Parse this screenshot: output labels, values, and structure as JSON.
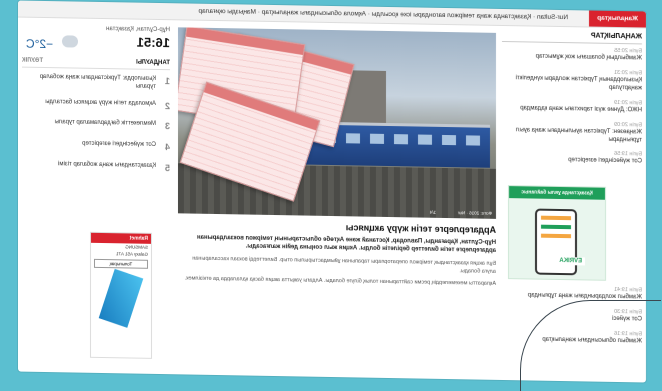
{
  "ticker": {
    "tag": "Жаңалықтар",
    "text": "Nur-Sultan · Қазақстанда жаңа теміржол вагондары іске қосылды · Ақмола облысындағы жаңалықтар · Маңызды оқиғалар"
  },
  "news_column": {
    "title": "ЖАҢАЛЫҚТАР",
    "items": [
      {
        "time": "Бүгін 20:55",
        "text": "Жамбылдың болашағы жоқ жұмыстар"
      },
      {
        "time": "Бүгін 20:31",
        "text": "Қызылорданың Түркістан жолдары күнделікті жаңартулар"
      },
      {
        "time": "Бүгін 20:19",
        "text": "НЖО: Дүние жүзі тарихтағы жаңа қадамдар"
      },
      {
        "time": "Бүгін 20:09",
        "text": "Жаңаөзен: Түркістан ауылындағы жаңа ауыл тұрғындары"
      },
      {
        "time": "Бүгін 19:56",
        "text": "Сот жүйесіндегі өзгерістер"
      },
      {
        "time": "Бүгін 19:41",
        "text": "Жамбыл жолдарындағы жаңа тұрғындар"
      },
      {
        "time": "Бүгін 19:30",
        "text": "Сот жүйесі"
      },
      {
        "time": "Бүгін 19:16",
        "text": "Жамбыл облысындағы жаңалықтар"
      }
    ]
  },
  "ad": {
    "header": "Қазақстанда ұялы байланыс",
    "logo": "EVRIKA"
  },
  "article": {
    "photo_credit": "Фото: 2016 · Nur",
    "photo_count": "1/4",
    "headline": "Ардагерлерге тегін жүру акциясы",
    "lead": "Нұр-Сұлтан, Қарағанды, Павлодар, Қостанай және Ақтөбе облыстарының теміржол вокзалдарынан ардагерлерге тегін билеттер берілетін болды. Акция жыл соңына дейін жалғасады.",
    "body_1": "Бұл акция қазақстандық теміржол операторлары тарапынан ұйымдастырылып отыр. Билеттерді вокзал кассаларынан алуға болады.",
    "body_2": "Ақпаратты мекемелердің ресми сайттарынан толық білуге болады. Алдағы уақытта акция басқа қалаларда да өткізілмек."
  },
  "sidebar": {
    "city": "Нұр-Сұлтан, Қазақстан",
    "time": "16:51",
    "temperature": "−2°C",
    "tabs": [
      "ТАҢДАУЛЫ",
      "ТӘУЛІК"
    ],
    "popular": [
      {
        "n": "1",
        "text": "Қызылорда: Түркістандағы жаңа жобалар туралы"
      },
      {
        "n": "2",
        "text": "Ақмолада тегін жүру акциясы басталды"
      },
      {
        "n": "3",
        "text": "Мемлекеттік бағдарламалар туралы"
      },
      {
        "n": "4",
        "text": "Сот жүйесіндегі өзгерістер"
      },
      {
        "n": "5",
        "text": "Қазақстандағы жаңа жобалар тізімі"
      }
    ],
    "banner": {
      "head": "Rahmet",
      "line1": "SAMSUNG",
      "line2": "Galaxy A51 A71",
      "button": "Толығырақ"
    }
  },
  "colors": {
    "background": "#5bbfd0",
    "accent": "#d9232e",
    "ad_green": "#1f9f5a"
  }
}
